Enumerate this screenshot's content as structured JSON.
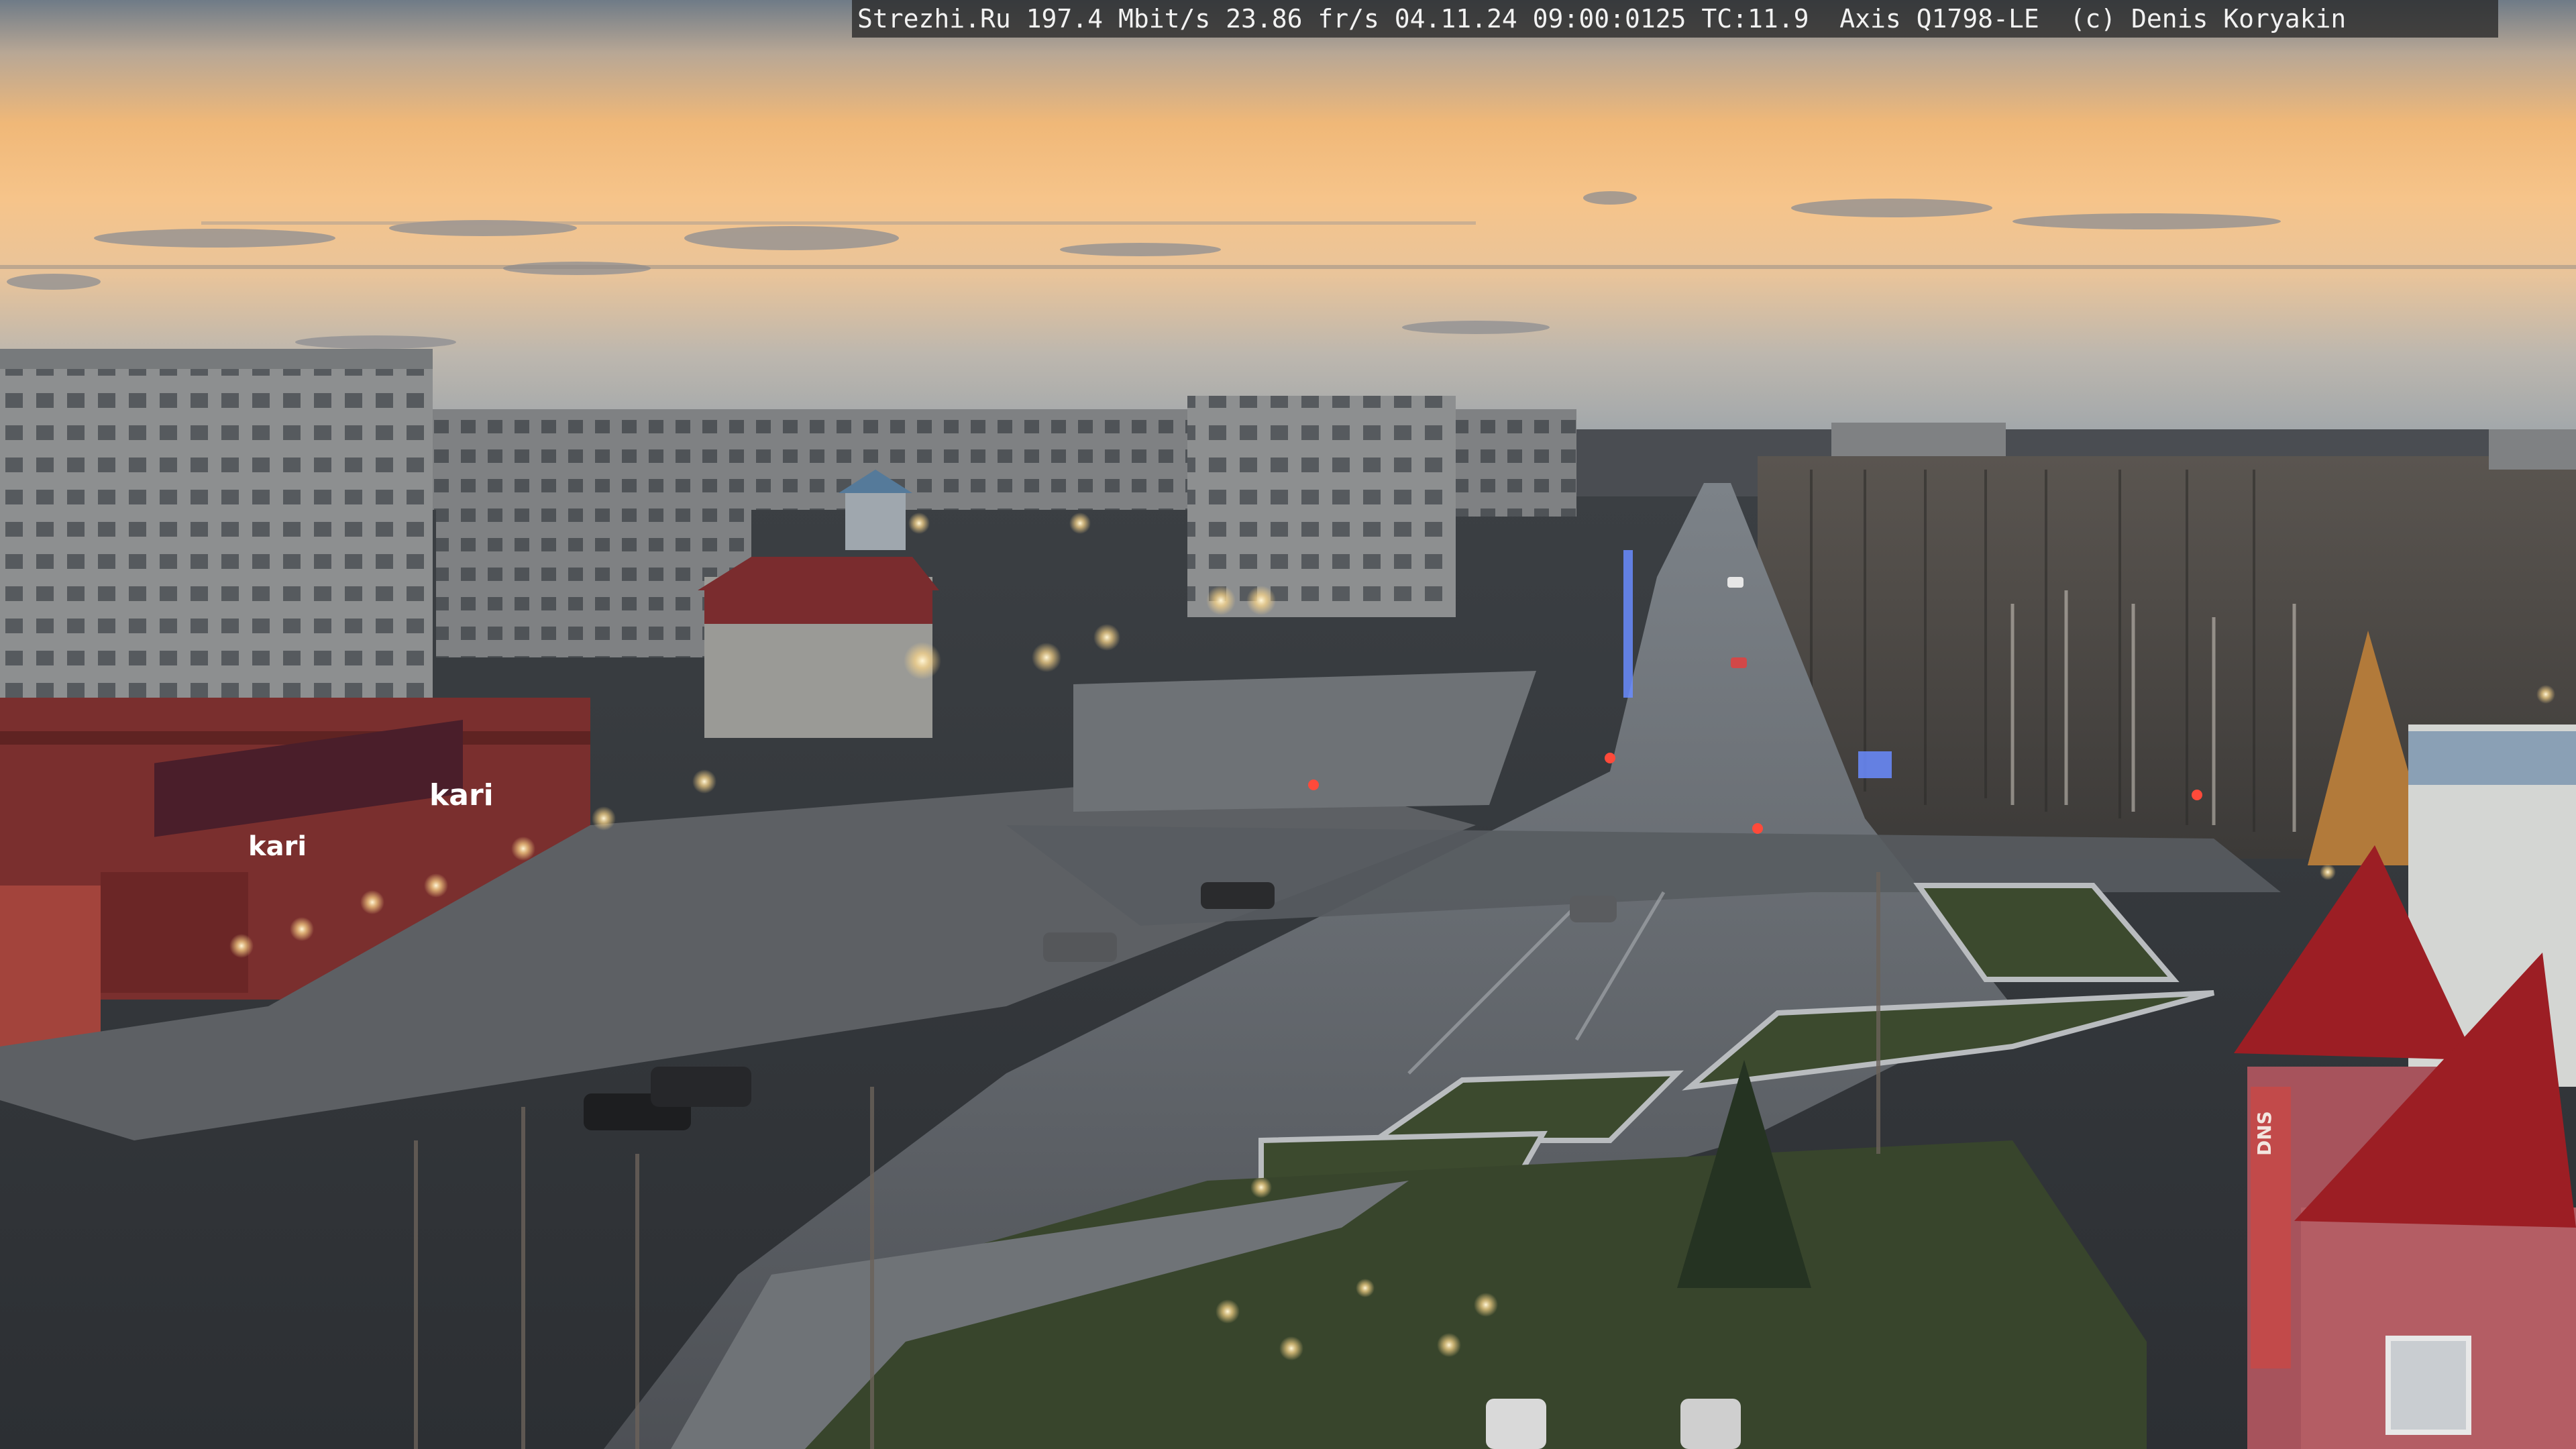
{
  "overlay": {
    "site": "Strezhi.Ru",
    "bitrate": "197.4 Mbit/s",
    "fps": "23.86 fr/s",
    "datetime": "04.11.24 09:00:0125",
    "tc": "TC:11.9",
    "camera": "Axis Q1798-LE",
    "copyright": "(c) Denis Koryakin"
  },
  "signs": {
    "store_kari_1": "kari",
    "store_kari_2": "kari",
    "store_dns": "DNS"
  },
  "colors": {
    "sky_top": "#6d7a86",
    "sky_glow": "#f2b676",
    "horizon": "#aab1b6",
    "road": "#55585d",
    "building_red": "#8a2b2e",
    "roof_red": "#9c1e24",
    "grass": "#3a4a2c",
    "lamp": "#ffe4a8"
  }
}
